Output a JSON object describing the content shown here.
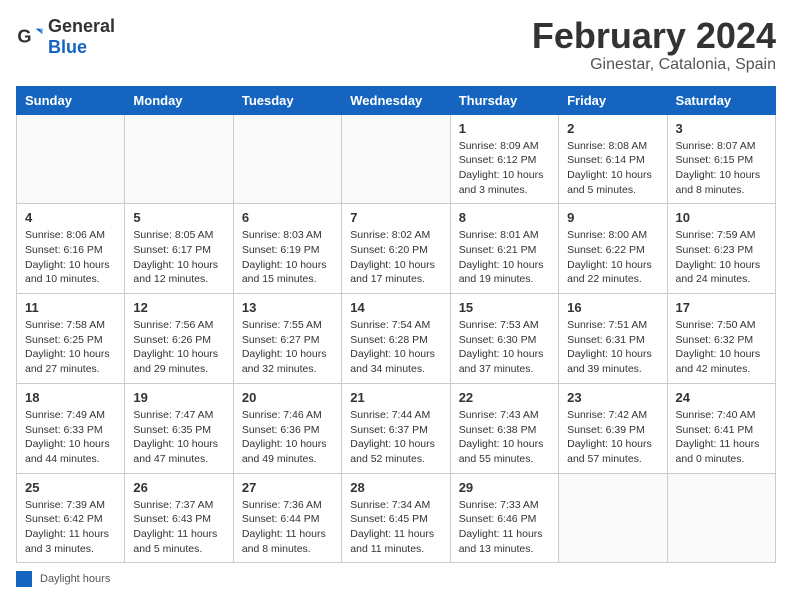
{
  "logo": {
    "general": "General",
    "blue": "Blue"
  },
  "title": "February 2024",
  "location": "Ginestar, Catalonia, Spain",
  "weekdays": [
    "Sunday",
    "Monday",
    "Tuesday",
    "Wednesday",
    "Thursday",
    "Friday",
    "Saturday"
  ],
  "legend": {
    "label": "Daylight hours"
  },
  "weeks": [
    [
      {
        "day": "",
        "info": ""
      },
      {
        "day": "",
        "info": ""
      },
      {
        "day": "",
        "info": ""
      },
      {
        "day": "",
        "info": ""
      },
      {
        "day": "1",
        "info": "Sunrise: 8:09 AM\nSunset: 6:12 PM\nDaylight: 10 hours\nand 3 minutes."
      },
      {
        "day": "2",
        "info": "Sunrise: 8:08 AM\nSunset: 6:14 PM\nDaylight: 10 hours\nand 5 minutes."
      },
      {
        "day": "3",
        "info": "Sunrise: 8:07 AM\nSunset: 6:15 PM\nDaylight: 10 hours\nand 8 minutes."
      }
    ],
    [
      {
        "day": "4",
        "info": "Sunrise: 8:06 AM\nSunset: 6:16 PM\nDaylight: 10 hours\nand 10 minutes."
      },
      {
        "day": "5",
        "info": "Sunrise: 8:05 AM\nSunset: 6:17 PM\nDaylight: 10 hours\nand 12 minutes."
      },
      {
        "day": "6",
        "info": "Sunrise: 8:03 AM\nSunset: 6:19 PM\nDaylight: 10 hours\nand 15 minutes."
      },
      {
        "day": "7",
        "info": "Sunrise: 8:02 AM\nSunset: 6:20 PM\nDaylight: 10 hours\nand 17 minutes."
      },
      {
        "day": "8",
        "info": "Sunrise: 8:01 AM\nSunset: 6:21 PM\nDaylight: 10 hours\nand 19 minutes."
      },
      {
        "day": "9",
        "info": "Sunrise: 8:00 AM\nSunset: 6:22 PM\nDaylight: 10 hours\nand 22 minutes."
      },
      {
        "day": "10",
        "info": "Sunrise: 7:59 AM\nSunset: 6:23 PM\nDaylight: 10 hours\nand 24 minutes."
      }
    ],
    [
      {
        "day": "11",
        "info": "Sunrise: 7:58 AM\nSunset: 6:25 PM\nDaylight: 10 hours\nand 27 minutes."
      },
      {
        "day": "12",
        "info": "Sunrise: 7:56 AM\nSunset: 6:26 PM\nDaylight: 10 hours\nand 29 minutes."
      },
      {
        "day": "13",
        "info": "Sunrise: 7:55 AM\nSunset: 6:27 PM\nDaylight: 10 hours\nand 32 minutes."
      },
      {
        "day": "14",
        "info": "Sunrise: 7:54 AM\nSunset: 6:28 PM\nDaylight: 10 hours\nand 34 minutes."
      },
      {
        "day": "15",
        "info": "Sunrise: 7:53 AM\nSunset: 6:30 PM\nDaylight: 10 hours\nand 37 minutes."
      },
      {
        "day": "16",
        "info": "Sunrise: 7:51 AM\nSunset: 6:31 PM\nDaylight: 10 hours\nand 39 minutes."
      },
      {
        "day": "17",
        "info": "Sunrise: 7:50 AM\nSunset: 6:32 PM\nDaylight: 10 hours\nand 42 minutes."
      }
    ],
    [
      {
        "day": "18",
        "info": "Sunrise: 7:49 AM\nSunset: 6:33 PM\nDaylight: 10 hours\nand 44 minutes."
      },
      {
        "day": "19",
        "info": "Sunrise: 7:47 AM\nSunset: 6:35 PM\nDaylight: 10 hours\nand 47 minutes."
      },
      {
        "day": "20",
        "info": "Sunrise: 7:46 AM\nSunset: 6:36 PM\nDaylight: 10 hours\nand 49 minutes."
      },
      {
        "day": "21",
        "info": "Sunrise: 7:44 AM\nSunset: 6:37 PM\nDaylight: 10 hours\nand 52 minutes."
      },
      {
        "day": "22",
        "info": "Sunrise: 7:43 AM\nSunset: 6:38 PM\nDaylight: 10 hours\nand 55 minutes."
      },
      {
        "day": "23",
        "info": "Sunrise: 7:42 AM\nSunset: 6:39 PM\nDaylight: 10 hours\nand 57 minutes."
      },
      {
        "day": "24",
        "info": "Sunrise: 7:40 AM\nSunset: 6:41 PM\nDaylight: 11 hours\nand 0 minutes."
      }
    ],
    [
      {
        "day": "25",
        "info": "Sunrise: 7:39 AM\nSunset: 6:42 PM\nDaylight: 11 hours\nand 3 minutes."
      },
      {
        "day": "26",
        "info": "Sunrise: 7:37 AM\nSunset: 6:43 PM\nDaylight: 11 hours\nand 5 minutes."
      },
      {
        "day": "27",
        "info": "Sunrise: 7:36 AM\nSunset: 6:44 PM\nDaylight: 11 hours\nand 8 minutes."
      },
      {
        "day": "28",
        "info": "Sunrise: 7:34 AM\nSunset: 6:45 PM\nDaylight: 11 hours\nand 11 minutes."
      },
      {
        "day": "29",
        "info": "Sunrise: 7:33 AM\nSunset: 6:46 PM\nDaylight: 11 hours\nand 13 minutes."
      },
      {
        "day": "",
        "info": ""
      },
      {
        "day": "",
        "info": ""
      }
    ]
  ]
}
